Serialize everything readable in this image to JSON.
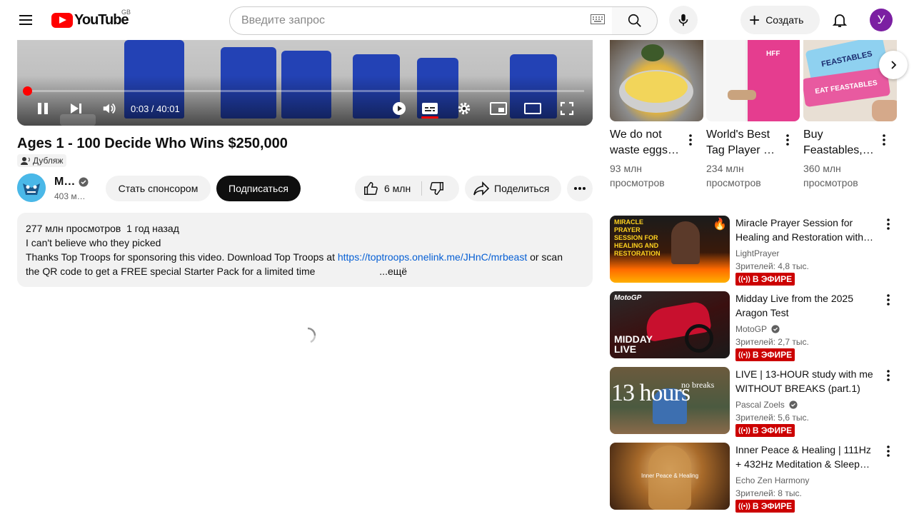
{
  "header": {
    "logo_text": "YouTube",
    "country_code": "GB",
    "search_placeholder": "Введите запрос",
    "create_label": "Создать",
    "avatar_letter": "У"
  },
  "player": {
    "time": "0:03 / 40:01",
    "progress": 0.00125,
    "accent": "#ff0000"
  },
  "video": {
    "title": "Ages 1 - 100 Decide Who Wins $250,000",
    "dub_label": "Дубляж",
    "channel_name": "M…",
    "channel_subs": "403 м…",
    "sponsor_label": "Стать спонсором",
    "subscribe_label": "Подписаться",
    "likes": "6 млн",
    "share_label": "Поделиться"
  },
  "description": {
    "views": "277 млн просмотров",
    "date": "1 год назад",
    "line1": "I can't believe who they picked",
    "line2_prefix": "Thanks Top Troops for sponsoring this video. Download Top Troops at",
    "link": "https://toptroops.onelink.me/JHnC/mrbeast",
    "line2_suffix": "or scan",
    "line3": "the QR code to get a FREE special Starter Pack for a limited time",
    "more": "...ещё"
  },
  "shorts": [
    {
      "title_line1": "We do not",
      "title_line2": "waste eggs…",
      "views_line1": "93 млн",
      "views_line2": "просмотров"
    },
    {
      "title_line1": "World's Best",
      "title_line2": "Tag Player …",
      "views_line1": "234 млн",
      "views_line2": "просмотров",
      "thumb_text": "HFF"
    },
    {
      "title_line1": "Buy",
      "title_line2": "Feastables,…",
      "views_line1": "360 млн",
      "views_line2": "просмотров",
      "thumb_text_1": "FEASTABLES",
      "thumb_text_2": "EAT FEASTABLES"
    }
  ],
  "recommendations": [
    {
      "title": "Miracle Prayer Session for Healing and Restoration with…",
      "channel": "LightPrayer",
      "meta": "Зрителей: 4,8 тыс.",
      "badge": "В ЭФИРЕ",
      "thumb_text": "MIRACLE PRAYER SESSION FOR HEALING AND RESTORATION"
    },
    {
      "title": "Midday Live from the 2025 Aragon Test",
      "channel": "MotoGP",
      "meta": "Зрителей: 2,7 тыс.",
      "badge": "В ЭФИРЕ",
      "thumb_text_1": "MotoGP",
      "thumb_text_2": "MIDDAY LIVE"
    },
    {
      "title": "LIVE | 13-HOUR study with me WITHOUT BREAKS (part.1) 📚…",
      "channel": "Pascal Zoels",
      "meta": "Зрителей: 5,6 тыс.",
      "badge": "В ЭФИРЕ",
      "thumb_text_1": "13 hours",
      "thumb_text_2": "no breaks"
    },
    {
      "title": "Inner Peace & Healing | 111Hz + 432Hz Meditation & Sleep…",
      "channel": "Echo Zen Harmony",
      "meta": "Зрителей: 8 тыс.",
      "badge": "В ЭФИРЕ",
      "thumb_text": "Inner Peace & Healing"
    }
  ],
  "colors": {
    "live_badge": "#cc0000",
    "subscribe_bg": "#0f0f0f",
    "link": "#065fd4"
  }
}
